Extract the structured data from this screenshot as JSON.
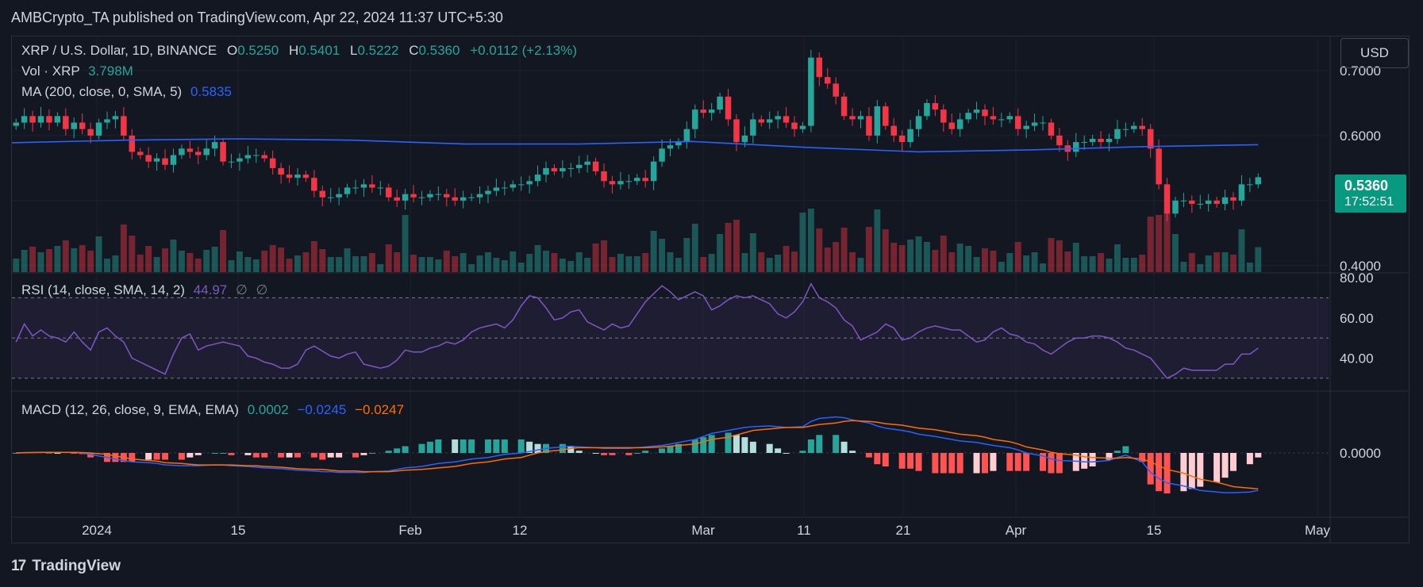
{
  "header": {
    "published_line": "AMBCrypto_TA published on TradingView.com, Apr 22, 2024 11:37 UTC+5:30"
  },
  "symbol": {
    "title": "XRP / U.S. Dollar, 1D, BINANCE",
    "open_label": "O",
    "open": "0.5250",
    "high_label": "H",
    "high": "0.5401",
    "low_label": "L",
    "low": "0.5222",
    "close_label": "C",
    "close": "0.5360",
    "change": "+0.0112 (+2.13%)"
  },
  "volume": {
    "label": "Vol · XRP",
    "value": "3.798M"
  },
  "ma": {
    "label": "MA (200, close, 0, SMA, 5)",
    "value": "0.5835"
  },
  "rsi": {
    "label": "RSI (14, close, SMA, 14, 2)",
    "value": "44.97",
    "extra1": "∅",
    "extra2": "∅"
  },
  "macd": {
    "label": "MACD (12, 26, close, 9, EMA, EMA)",
    "v1": "0.0002",
    "v2": "−0.0245",
    "v3": "−0.0247"
  },
  "currency_button": "USD",
  "last_price": {
    "price": "0.5360",
    "countdown": "17:52:51"
  },
  "footer": {
    "brand": "TradingView",
    "logo": "17"
  },
  "colors": {
    "up": "#26a69a",
    "down": "#f23645",
    "ma": "#2962ff",
    "rsi": "#7e57c2",
    "macd": "#2962ff",
    "signal": "#ff6d00"
  },
  "chart_data": [
    {
      "type": "candlestick",
      "title": "XRP / U.S. Dollar, 1D, BINANCE",
      "x_ticks": [
        "2024",
        "15",
        "Feb",
        "12",
        "Mar",
        "11",
        "21",
        "Apr",
        "15",
        "May"
      ],
      "y_ticks": [
        "0.7000",
        "0.6000",
        "0.4000"
      ],
      "ylim": [
        0.39,
        0.75
      ],
      "close": [
        0.62,
        0.63,
        0.62,
        0.63,
        0.62,
        0.63,
        0.61,
        0.62,
        0.61,
        0.6,
        0.62,
        0.625,
        0.63,
        0.6,
        0.575,
        0.57,
        0.56,
        0.565,
        0.555,
        0.57,
        0.58,
        0.575,
        0.57,
        0.58,
        0.59,
        0.56,
        0.56,
        0.565,
        0.57,
        0.57,
        0.565,
        0.55,
        0.54,
        0.535,
        0.54,
        0.535,
        0.515,
        0.505,
        0.505,
        0.51,
        0.52,
        0.52,
        0.525,
        0.52,
        0.52,
        0.505,
        0.5,
        0.51,
        0.505,
        0.505,
        0.51,
        0.51,
        0.505,
        0.5,
        0.505,
        0.505,
        0.51,
        0.515,
        0.52,
        0.52,
        0.525,
        0.525,
        0.53,
        0.54,
        0.55,
        0.545,
        0.55,
        0.55,
        0.555,
        0.56,
        0.545,
        0.53,
        0.525,
        0.53,
        0.53,
        0.535,
        0.53,
        0.56,
        0.58,
        0.585,
        0.59,
        0.61,
        0.64,
        0.635,
        0.64,
        0.66,
        0.625,
        0.59,
        0.6,
        0.625,
        0.62,
        0.625,
        0.63,
        0.62,
        0.61,
        0.615,
        0.72,
        0.69,
        0.68,
        0.66,
        0.63,
        0.625,
        0.63,
        0.6,
        0.645,
        0.615,
        0.6,
        0.59,
        0.61,
        0.63,
        0.65,
        0.64,
        0.62,
        0.61,
        0.625,
        0.635,
        0.64,
        0.63,
        0.625,
        0.625,
        0.63,
        0.61,
        0.615,
        0.62,
        0.62,
        0.6,
        0.585,
        0.575,
        0.59,
        0.59,
        0.595,
        0.59,
        0.595,
        0.61,
        0.61,
        0.615,
        0.61,
        0.58,
        0.525,
        0.48,
        0.5,
        0.5,
        0.495,
        0.495,
        0.5,
        0.495,
        0.505,
        0.5,
        0.525,
        0.525,
        0.536
      ],
      "series": [
        {
          "name": "MA (200, close, 0, SMA, 5)",
          "values": [
            0.589,
            0.593,
            0.595,
            0.593,
            0.587,
            0.587,
            0.591,
            0.582,
            0.575,
            0.578,
            0.583,
            0.586
          ]
        }
      ]
    },
    {
      "type": "line",
      "title": "RSI (14, close, SMA, 14, 2)",
      "y_ticks": [
        "80.00",
        "60.00",
        "40.00"
      ],
      "ylim": [
        24,
        82
      ],
      "values": [
        48,
        57,
        51,
        54,
        51,
        50,
        48,
        53,
        48,
        44,
        53,
        55,
        51,
        48,
        40,
        38,
        36,
        34,
        32,
        42,
        50,
        52,
        44,
        46,
        47,
        48,
        47,
        46,
        41,
        40,
        38,
        37,
        35,
        35,
        37,
        44,
        46,
        41,
        40,
        42,
        43,
        37,
        36,
        35,
        36,
        39,
        44,
        43,
        43,
        45,
        46,
        48,
        47,
        49,
        53,
        55,
        56,
        57,
        55,
        59,
        66,
        71,
        70,
        65,
        59,
        60,
        63,
        64,
        58,
        56,
        54,
        57,
        55,
        56,
        62,
        68,
        72,
        76,
        73,
        69,
        71,
        73,
        71,
        64,
        66,
        69,
        71,
        70,
        71,
        69,
        67,
        62,
        60,
        63,
        68,
        77,
        70,
        68,
        65,
        59,
        56,
        49,
        51,
        53,
        57,
        55,
        49,
        50,
        53,
        55,
        56,
        54,
        54,
        51,
        48,
        49,
        53,
        55,
        52,
        51,
        48,
        47,
        44,
        42,
        45,
        48,
        50,
        50,
        51,
        51,
        50,
        48,
        45,
        44,
        42,
        40,
        35,
        30,
        32,
        35,
        34,
        34,
        34,
        34,
        37,
        37,
        42,
        42,
        45
      ],
      "reference_lines": [
        70,
        50,
        30
      ]
    },
    {
      "type": "bar+line",
      "title": "MACD (12, 26, close, 9, EMA, EMA)",
      "y_ticks": [
        "0.0000"
      ],
      "series": [
        {
          "name": "MACD",
          "values": [
            0.0,
            0.0005,
            0.001,
            0.001,
            0.0008,
            0.0005,
            0.0,
            -0.002,
            -0.006,
            -0.008,
            -0.01,
            -0.012,
            -0.013,
            -0.014,
            -0.016,
            -0.017,
            -0.017,
            -0.017,
            -0.016,
            -0.016,
            -0.017,
            -0.018,
            -0.019,
            -0.02,
            -0.021,
            -0.022,
            -0.023,
            -0.024,
            -0.025,
            -0.025,
            -0.026,
            -0.026,
            -0.026,
            -0.025,
            -0.024,
            -0.022,
            -0.02,
            -0.018,
            -0.016,
            -0.014,
            -0.012,
            -0.01,
            -0.008,
            -0.006,
            -0.004,
            -0.002,
            0.0,
            0.002,
            0.004,
            0.006,
            0.008,
            0.009,
            0.008,
            0.007,
            0.006,
            0.006,
            0.006,
            0.007,
            0.008,
            0.01,
            0.012,
            0.014,
            0.018,
            0.022,
            0.026,
            0.03,
            0.032,
            0.034,
            0.035,
            0.036,
            0.035,
            0.034,
            0.035,
            0.042,
            0.046,
            0.048,
            0.047,
            0.044,
            0.04,
            0.036,
            0.033,
            0.03,
            0.028,
            0.025,
            0.022,
            0.02,
            0.018,
            0.016,
            0.014,
            0.012,
            0.01,
            0.007,
            0.004,
            0.0,
            -0.004,
            -0.008,
            -0.01,
            -0.011,
            -0.012,
            -0.012,
            -0.01,
            -0.006,
            -0.003,
            -0.012,
            -0.026,
            -0.034,
            -0.04,
            -0.044,
            -0.047,
            -0.05,
            -0.052,
            -0.053,
            -0.053,
            -0.052,
            -0.05
          ]
        },
        {
          "name": "Signal",
          "values": [
            0.0,
            0.0003,
            0.0006,
            0.0008,
            0.0008,
            0.0007,
            0.0005,
            0.0,
            -0.002,
            -0.004,
            -0.006,
            -0.008,
            -0.01,
            -0.011,
            -0.013,
            -0.014,
            -0.015,
            -0.016,
            -0.016,
            -0.016,
            -0.016,
            -0.017,
            -0.017,
            -0.018,
            -0.019,
            -0.02,
            -0.021,
            -0.022,
            -0.022,
            -0.023,
            -0.024,
            -0.024,
            -0.025,
            -0.025,
            -0.025,
            -0.024,
            -0.023,
            -0.022,
            -0.021,
            -0.02,
            -0.018,
            -0.016,
            -0.014,
            -0.012,
            -0.01,
            -0.008,
            -0.006,
            -0.003,
            0.0,
            0.002,
            0.004,
            0.006,
            0.007,
            0.007,
            0.007,
            0.007,
            0.007,
            0.007,
            0.007,
            0.008,
            0.009,
            0.01,
            0.012,
            0.015,
            0.018,
            0.021,
            0.024,
            0.027,
            0.03,
            0.032,
            0.033,
            0.034,
            0.034,
            0.036,
            0.038,
            0.04,
            0.042,
            0.043,
            0.042,
            0.041,
            0.039,
            0.037,
            0.035,
            0.033,
            0.031,
            0.029,
            0.027,
            0.025,
            0.023,
            0.021,
            0.018,
            0.015,
            0.012,
            0.008,
            0.004,
            0.001,
            -0.001,
            -0.003,
            -0.005,
            -0.006,
            -0.007,
            -0.007,
            -0.006,
            -0.008,
            -0.012,
            -0.017,
            -0.022,
            -0.027,
            -0.031,
            -0.035,
            -0.039,
            -0.042,
            -0.045,
            -0.047,
            -0.048
          ]
        }
      ]
    }
  ]
}
